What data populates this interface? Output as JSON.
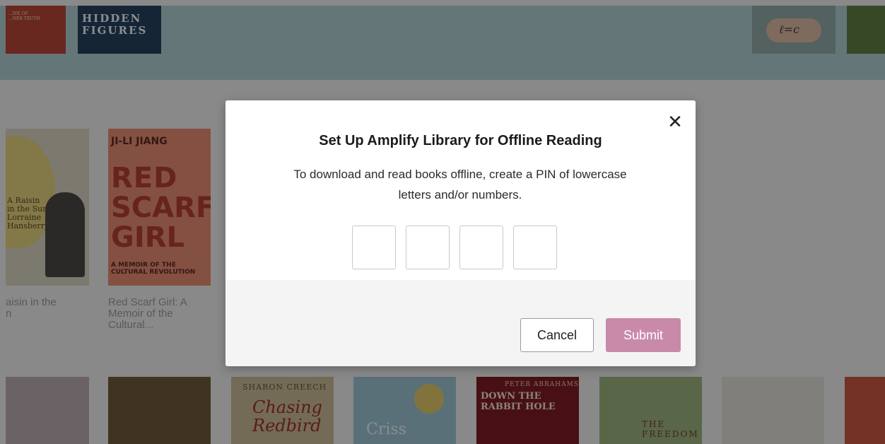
{
  "background": {
    "top_row": [
      {
        "cover_text": "...IVE OF\n...NER TRUTH"
      },
      {
        "cover_text": "HIDDEN\nFIGURES"
      },
      {
        "cover_text": "ℓ=c"
      },
      {
        "cover_text": ""
      }
    ],
    "middle_row": [
      {
        "cover_text": "A Raisin\nin the Sun\nLorraine\nHansberry",
        "caption": "aisin in the\nn"
      },
      {
        "cover_top": "JI-LI JIANG",
        "cover_title_1": "RED",
        "cover_title_2": "SCARF",
        "cover_title_3": "GIRL",
        "cover_sub": "A MEMOIR OF THE CULTURAL REVOLUTION",
        "caption": "Red Scarf Girl: A\nMemoir of the\nCultural..."
      }
    ],
    "bottom_row": [
      {
        "cover_text": ""
      },
      {
        "cover_text": ""
      },
      {
        "author": "SHARON CREECH",
        "title": "Chasing\nRedbird"
      },
      {
        "title": "Criss"
      },
      {
        "author": "PETER ABRAHAMS",
        "title": "DOWN THE RABBIT HOLE"
      },
      {
        "title": "THE\nFREEDOM"
      },
      {
        "cover_text": ""
      },
      {
        "cover_text": ""
      }
    ]
  },
  "modal": {
    "close_glyph": "✕",
    "title": "Set Up Amplify Library for Offline Reading",
    "description": "To download and read books offline, create a PIN of lowercase letters and/or numbers.",
    "pin_values": [
      "",
      "",
      "",
      ""
    ],
    "cancel_label": "Cancel",
    "submit_label": "Submit",
    "submit_color": "#c98aaa"
  }
}
